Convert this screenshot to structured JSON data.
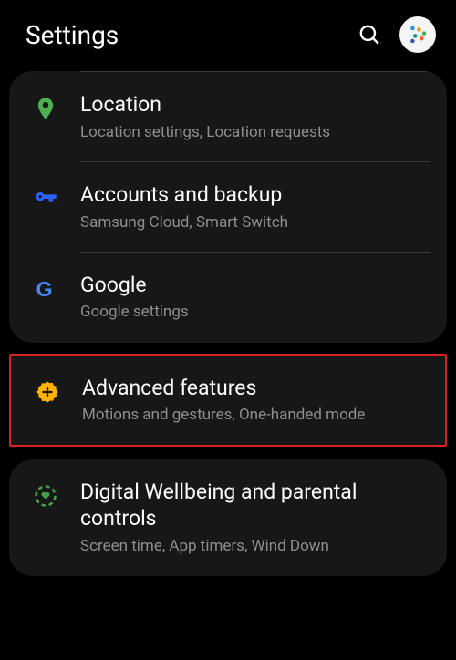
{
  "header": {
    "title": "Settings"
  },
  "groups": [
    {
      "items": [
        {
          "title": "Location",
          "subtitle": "Location settings, Location requests",
          "icon": "location",
          "color": "#4CAF50"
        },
        {
          "title": "Accounts and backup",
          "subtitle": "Samsung Cloud, Smart Switch",
          "icon": "key",
          "color": "#2962FF"
        },
        {
          "title": "Google",
          "subtitle": "Google settings",
          "icon": "google",
          "color": "#4285F4"
        }
      ]
    },
    {
      "highlighted": true,
      "items": [
        {
          "title": "Advanced features",
          "subtitle": "Motions and gestures, One-handed mode",
          "icon": "plus-badge",
          "color": "#FFB300"
        }
      ]
    },
    {
      "items": [
        {
          "title": "Digital Wellbeing and parental controls",
          "subtitle": "Screen time, App timers, Wind Down",
          "icon": "wellbeing",
          "color": "#43A047"
        }
      ]
    }
  ]
}
